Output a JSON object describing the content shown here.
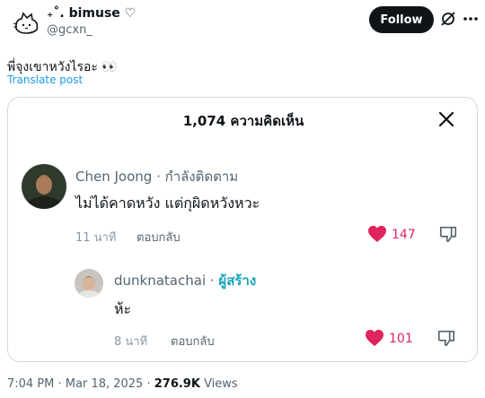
{
  "post": {
    "display_name": "₊˚. bimuse ♡",
    "handle": "@gcxn_",
    "follow_label": "Follow",
    "text": "พี่จุงเขาหวังไรอะ 👀",
    "translate_label": "Translate post",
    "timestamp": "7:04 PM · Mar 18, 2025 · ",
    "views_count": "276.9K",
    "views_label": " Views"
  },
  "card": {
    "title": "1,074 ความคิดเห็น",
    "comments": [
      {
        "name": "Chen Joong",
        "separator": " · ",
        "tag": "กำลังติดตาม",
        "body": "ไม่ได้คาดหวัง แต่กุผิดหวังหวะ",
        "time": "11 นาที",
        "reply_label": "ตอบกลับ",
        "likes": "147"
      },
      {
        "name": "dunknatachai",
        "separator": " · ",
        "tag": "ผู้สร้าง",
        "body": "ห้ะ",
        "time": "8 นาที",
        "reply_label": "ตอบกลับ",
        "likes": "101"
      }
    ]
  },
  "colors": {
    "like": "#e0245e",
    "creator_tag": "#1ba3b8",
    "link": "#1d9bf0"
  }
}
